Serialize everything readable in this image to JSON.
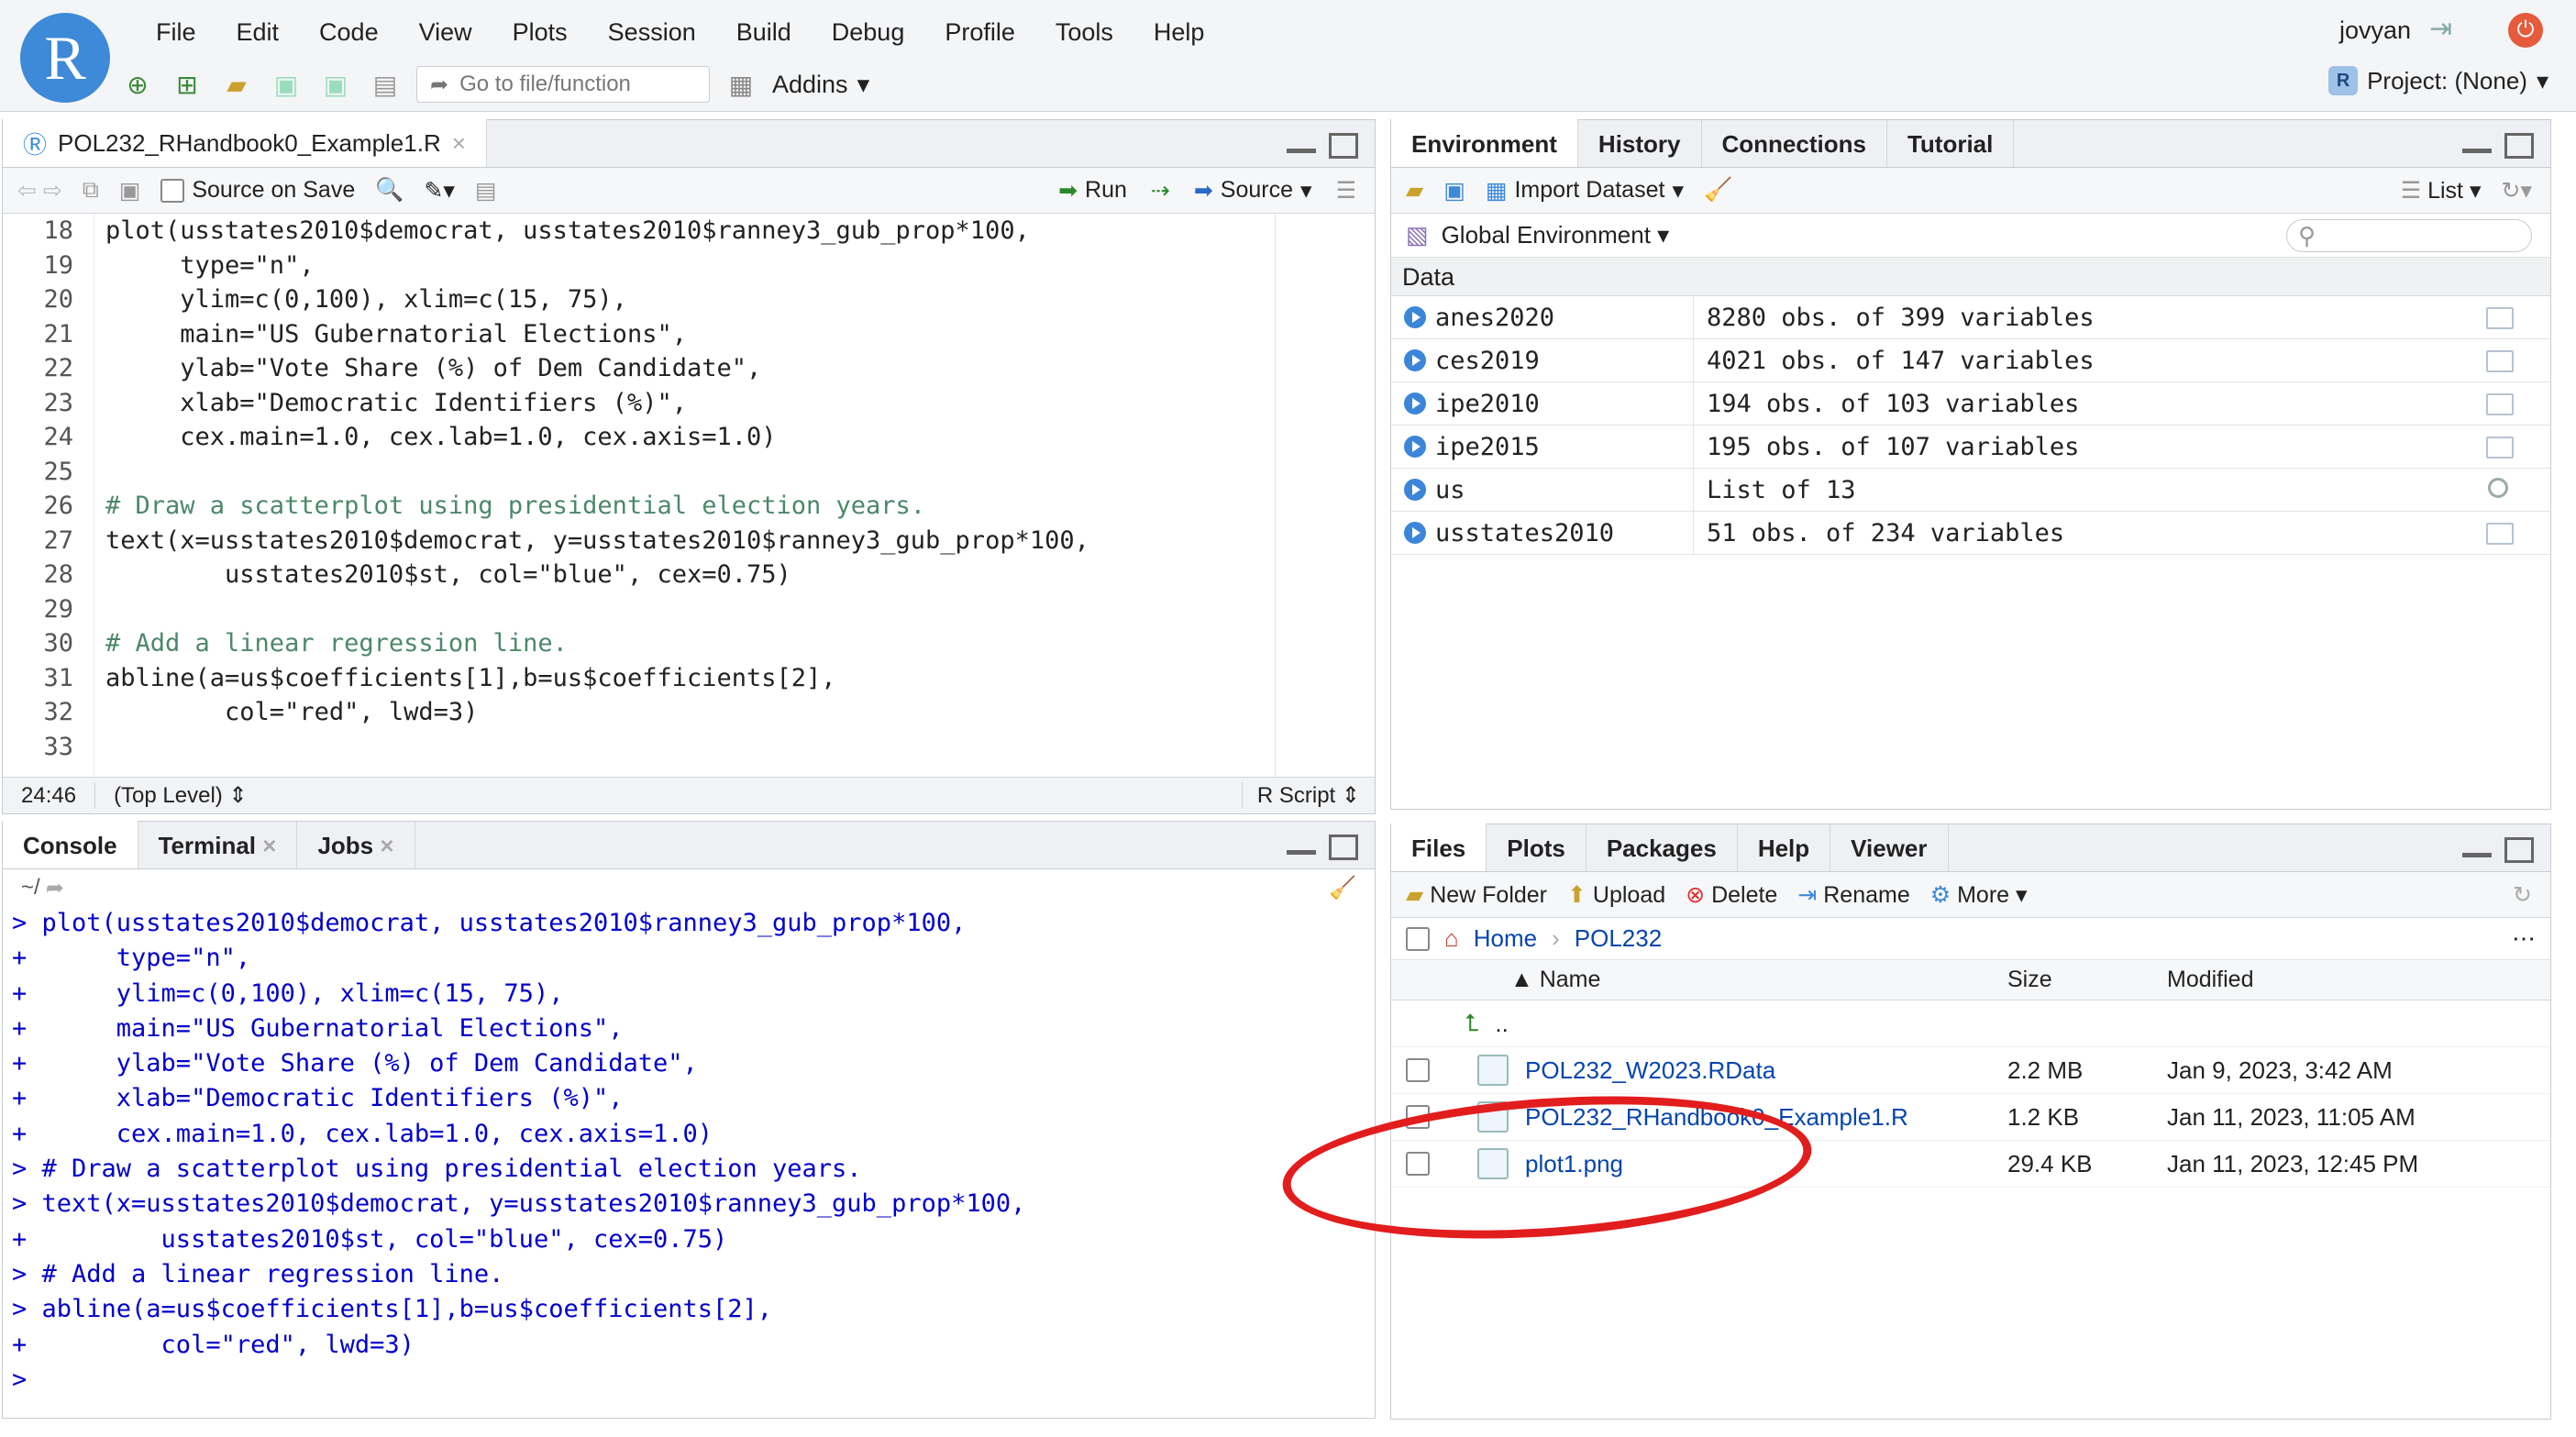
{
  "menubar": {
    "items": [
      "File",
      "Edit",
      "Code",
      "View",
      "Plots",
      "Session",
      "Build",
      "Debug",
      "Profile",
      "Tools",
      "Help"
    ]
  },
  "logo": "R",
  "user": "jovyan",
  "toolbar": {
    "goto_placeholder": "Go to file/function",
    "addins": "Addins"
  },
  "project": "Project: (None)",
  "editor": {
    "tab_title": "POL232_RHandbook0_Example1.R",
    "source_on_save": "Source on Save",
    "run": "Run",
    "source": "Source",
    "line_numbers": [
      "18",
      "19",
      "20",
      "21",
      "22",
      "23",
      "24",
      "25",
      "26",
      "27",
      "28",
      "29",
      "30",
      "31",
      "32",
      "33"
    ],
    "lines": [
      "plot(usstates2010$democrat, usstates2010$ranney3_gub_prop*100,",
      "     type=\"n\",",
      "     ylim=c(0,100), xlim=c(15, 75),",
      "     main=\"US Gubernatorial Elections\",",
      "     ylab=\"Vote Share (%) of Dem Candidate\",",
      "     xlab=\"Democratic Identifiers (%)\",",
      "     cex.main=1.0, cex.lab=1.0, cex.axis=1.0)",
      "",
      "# Draw a scatterplot using presidential election years.",
      "text(x=usstates2010$democrat, y=usstates2010$ranney3_gub_prop*100,",
      "        usstates2010$st, col=\"blue\", cex=0.75)",
      "",
      "# Add a linear regression line.",
      "abline(a=us$coefficients[1],b=us$coefficients[2],",
      "        col=\"red\", lwd=3)",
      ""
    ],
    "cursor_pos": "24:46",
    "scope": "(Top Level)",
    "file_type": "R Script"
  },
  "console": {
    "tabs": [
      "Console",
      "Terminal",
      "Jobs"
    ],
    "path": "~/",
    "lines": [
      "> plot(usstates2010$democrat, usstates2010$ranney3_gub_prop*100,",
      "+      type=\"n\",",
      "+      ylim=c(0,100), xlim=c(15, 75),",
      "+      main=\"US Gubernatorial Elections\",",
      "+      ylab=\"Vote Share (%) of Dem Candidate\",",
      "+      xlab=\"Democratic Identifiers (%)\",",
      "+      cex.main=1.0, cex.lab=1.0, cex.axis=1.0)",
      "> # Draw a scatterplot using presidential election years.",
      "> text(x=usstates2010$democrat, y=usstates2010$ranney3_gub_prop*100,",
      "+         usstates2010$st, col=\"blue\", cex=0.75)",
      "> # Add a linear regression line.",
      "> abline(a=us$coefficients[1],b=us$coefficients[2],",
      "+         col=\"red\", lwd=3)",
      "> "
    ]
  },
  "environment": {
    "tabs": [
      "Environment",
      "History",
      "Connections",
      "Tutorial"
    ],
    "import_dataset": "Import Dataset",
    "view_mode": "List",
    "scope": "Global Environment",
    "section": "Data",
    "rows": [
      {
        "name": "anes2020",
        "value": "8280 obs. of 399 variables",
        "icon": "grid"
      },
      {
        "name": "ces2019",
        "value": "4021 obs. of 147 variables",
        "icon": "grid"
      },
      {
        "name": "ipe2010",
        "value": "194 obs. of 103 variables",
        "icon": "grid"
      },
      {
        "name": "ipe2015",
        "value": "195 obs. of 107 variables",
        "icon": "grid"
      },
      {
        "name": "us",
        "value": "List of 13",
        "icon": "search"
      },
      {
        "name": "usstates2010",
        "value": "51 obs. of 234 variables",
        "icon": "grid"
      }
    ]
  },
  "files": {
    "tabs": [
      "Files",
      "Plots",
      "Packages",
      "Help",
      "Viewer"
    ],
    "actions": {
      "new_folder": "New Folder",
      "upload": "Upload",
      "delete": "Delete",
      "rename": "Rename",
      "more": "More"
    },
    "breadcrumb": [
      "Home",
      "POL232"
    ],
    "columns": {
      "name": "Name",
      "size": "Size",
      "modified": "Modified"
    },
    "parent": "..",
    "rows": [
      {
        "name": "POL232_W2023.RData",
        "size": "2.2 MB",
        "modified": "Jan 9, 2023, 3:42 AM"
      },
      {
        "name": "POL232_RHandbook0_Example1.R",
        "size": "1.2 KB",
        "modified": "Jan 11, 2023, 11:05 AM"
      },
      {
        "name": "plot1.png",
        "size": "29.4 KB",
        "modified": "Jan 11, 2023, 12:45 PM"
      }
    ]
  },
  "colors": {
    "accent": "#3e8ad8",
    "annotation": "#e21d1d",
    "link": "#0645ad"
  }
}
